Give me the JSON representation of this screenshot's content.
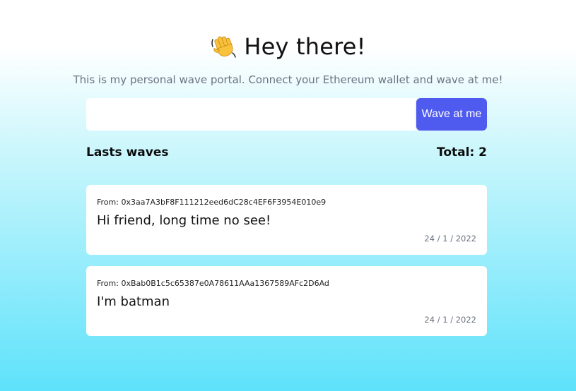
{
  "header": {
    "icon": "waving-hand-icon",
    "title": "Hey there!"
  },
  "subtitle": "This is my personal wave portal. Connect your Ethereum wallet and wave at me!",
  "form": {
    "input_value": "",
    "input_placeholder": "",
    "button_label": "Wave at me"
  },
  "waves_section": {
    "title": "Lasts waves",
    "total_label": "Total: 2"
  },
  "waves": [
    {
      "from": "From: 0x3aa7A3bF8F111212eed6dC28c4EF6F3954E010e9",
      "message": "Hi friend, long time no see!",
      "date": "24 / 1 / 2022"
    },
    {
      "from": "From: 0xBab0B1c5c65387e0A78611AAa1367589AFc2D6Ad",
      "message": "I'm batman",
      "date": "24 / 1 / 2022"
    }
  ],
  "colors": {
    "accent": "#4f5bef",
    "background_top": "#ffffff",
    "background_bottom": "#5ee2fb",
    "card": "#ffffff",
    "muted_text": "#6b7280"
  }
}
